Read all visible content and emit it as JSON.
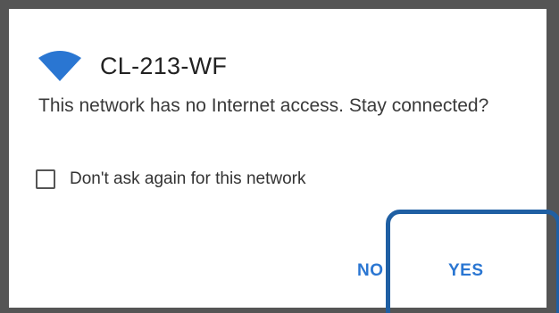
{
  "dialog": {
    "network_name": "CL-213-WF",
    "message": "This network has no Internet access. Stay connected?",
    "checkbox_label": "Don't ask again for this network",
    "checkbox_checked": false,
    "buttons": {
      "no_label": "NO",
      "yes_label": "YES"
    }
  },
  "icons": {
    "network": "wifi-icon"
  },
  "colors": {
    "accent": "#2a76d2",
    "highlight": "#1f5fa3",
    "frame": "#555555"
  }
}
